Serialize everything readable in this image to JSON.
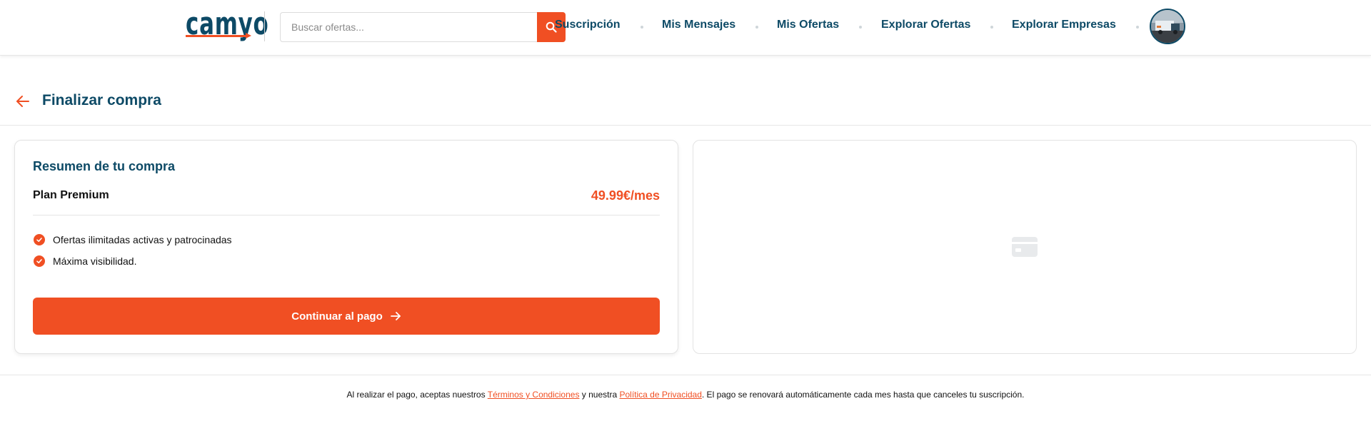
{
  "header": {
    "logo_text": "camyo",
    "search": {
      "placeholder": "Buscar ofertas...",
      "value": ""
    },
    "nav": [
      {
        "label": "Suscripción"
      },
      {
        "label": "Mis Mensajes"
      },
      {
        "label": "Mis Ofertas"
      },
      {
        "label": "Explorar Ofertas"
      },
      {
        "label": "Explorar Empresas"
      }
    ]
  },
  "page": {
    "title": "Finalizar compra"
  },
  "summary": {
    "title": "Resumen de tu compra",
    "plan_name": "Plan Premium",
    "plan_price": "49.99€/mes",
    "features": [
      "Ofertas ilimitadas activas y patrocinadas",
      "Máxima visibilidad."
    ],
    "button_label": "Continuar al pago"
  },
  "footer": {
    "text_1": "Al realizar el pago, aceptas nuestros ",
    "terms_link": "Términos y Condiciones",
    "text_2": " y nuestra ",
    "privacy_link": "Política de Privacidad",
    "text_3": ". El pago se renovará automáticamente cada mes hasta que canceles tu suscripción."
  },
  "colors": {
    "brand_blue": "#0d4a66",
    "accent_orange": "#f04f23"
  },
  "icons": [
    "search-icon",
    "back-arrow-icon",
    "check-icon",
    "arrow-right-icon",
    "credit-card-icon",
    "avatar"
  ]
}
